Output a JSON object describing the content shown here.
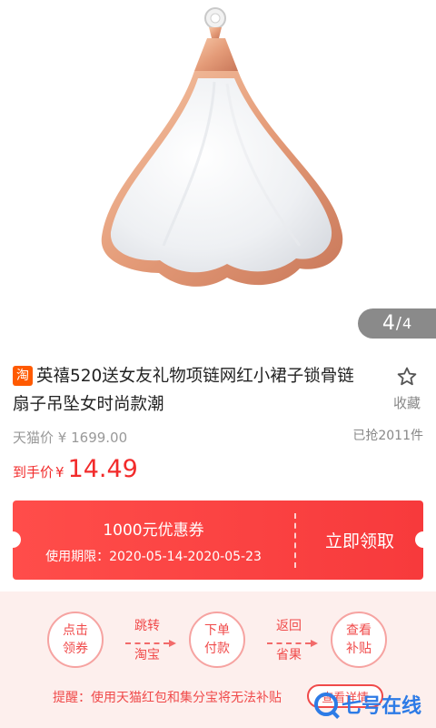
{
  "gallery": {
    "current": "4",
    "separator": "/",
    "total": "4"
  },
  "product": {
    "store_badge": "淘",
    "title": "英禧520送女友礼物项链网红小裙子锁骨链扇子吊坠女时尚款潮",
    "favorite_label": "收藏",
    "original_price_label": "天猫价",
    "original_price": "¥ 1699.00",
    "sold_count": "已抢2011件",
    "final_price_label": "到手价",
    "final_price_currency": "¥",
    "final_price": "14.49"
  },
  "coupon": {
    "title": "1000元优惠券",
    "validity": "使用期限：2020-05-14-2020-05-23",
    "claim_label": "立即领取"
  },
  "steps": [
    {
      "line1": "点击",
      "line2": "领券"
    },
    {
      "line1": "跳转",
      "line2": "淘宝"
    },
    {
      "line1": "下单",
      "line2": "付款"
    },
    {
      "line1": "返回",
      "line2": "省果"
    },
    {
      "line1": "查看",
      "line2": "补贴"
    }
  ],
  "reminder": {
    "text": "提醒：使用天猫红包和集分宝将无法补贴",
    "detail_label": "查看详情"
  },
  "watermark": {
    "text": "七号在线"
  },
  "colors": {
    "accent_red": "#f22b2b",
    "coupon_red": "#ff4d4a",
    "tmall_badge": "#ff5a00",
    "rose_gold": "#e8a07e",
    "steps_bg": "#fdefed"
  }
}
